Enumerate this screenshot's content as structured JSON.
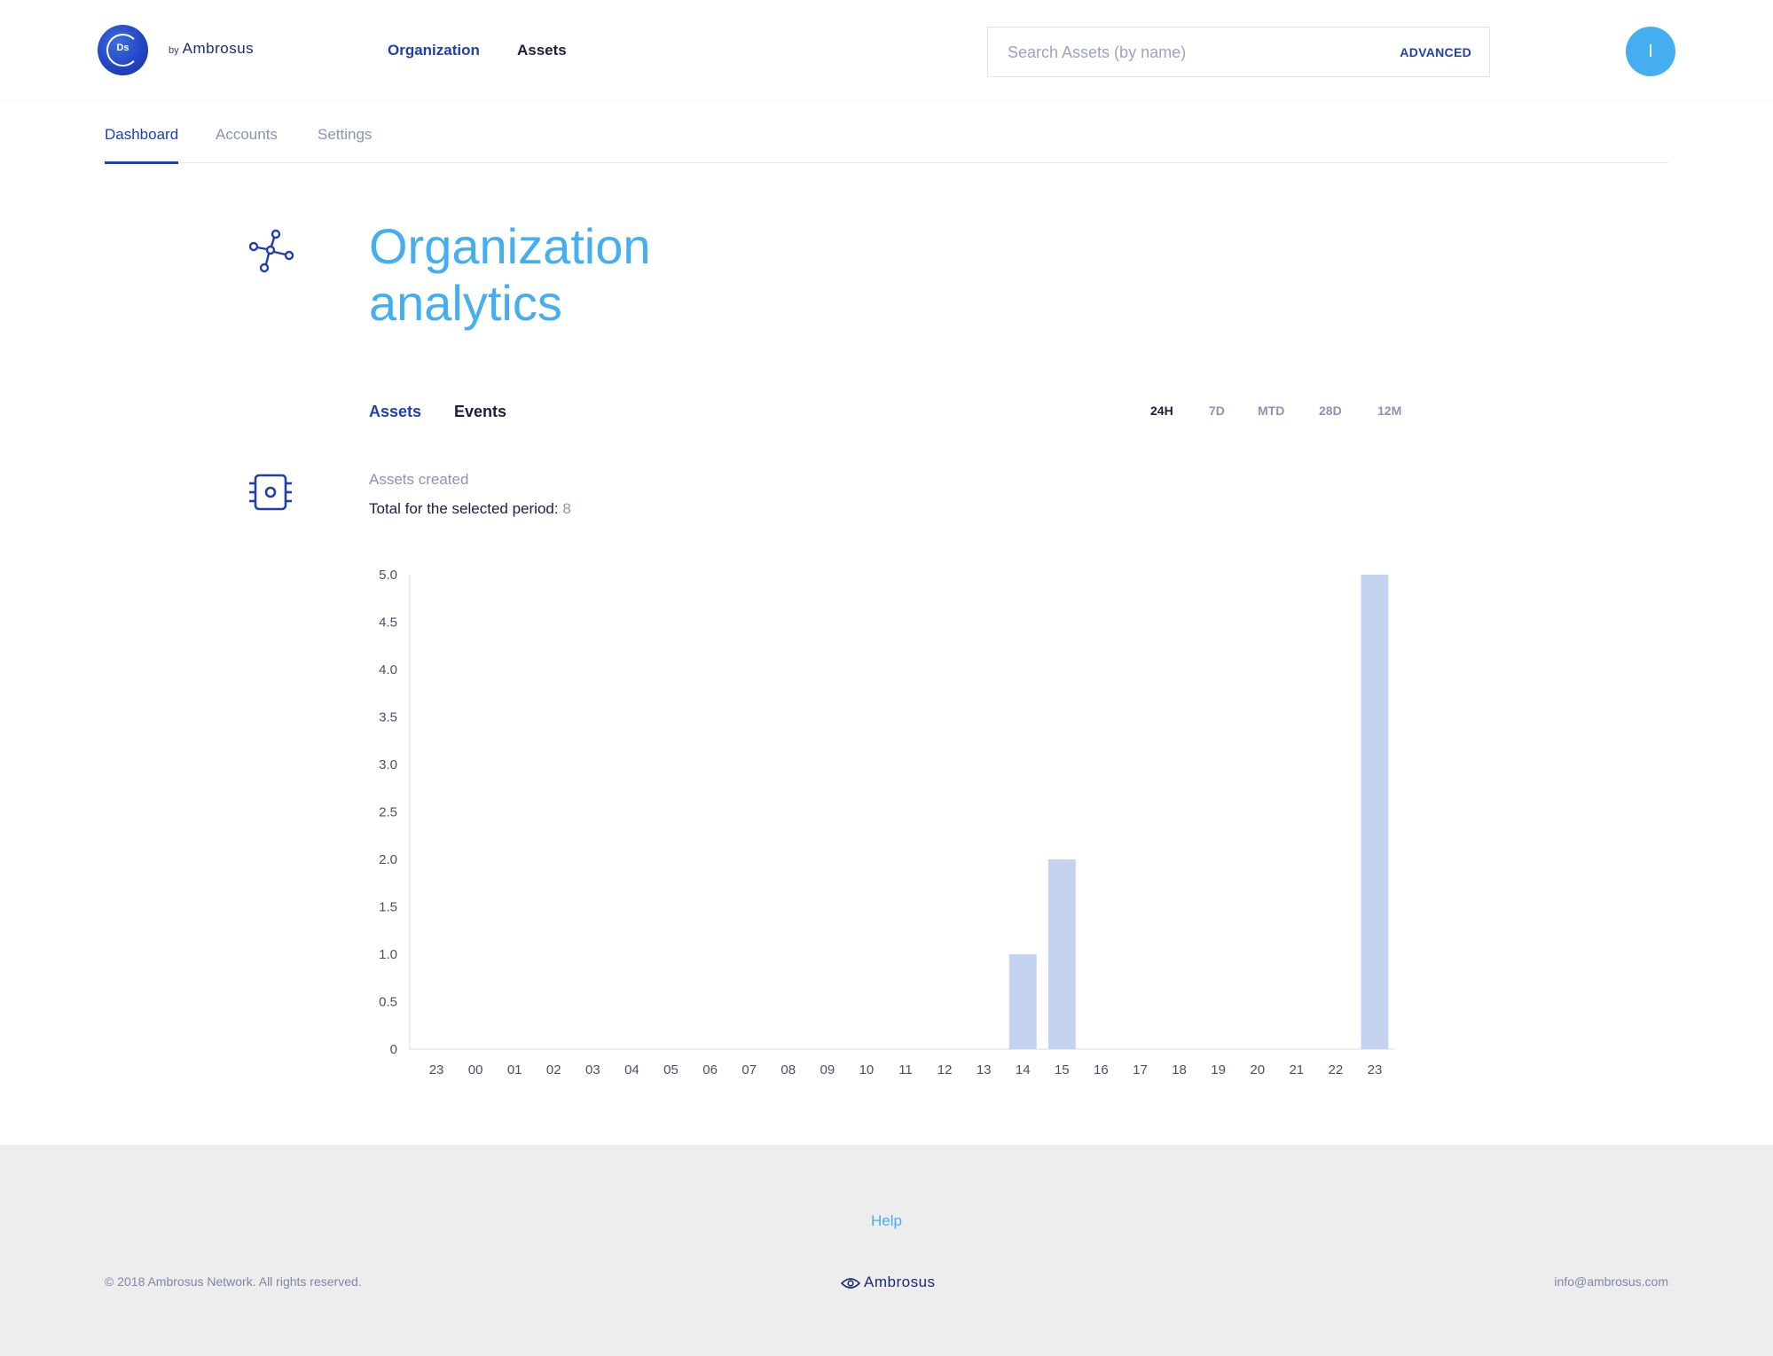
{
  "header": {
    "logo_text": "Ds",
    "by_text": "by",
    "brand": "Ambrosus",
    "nav": [
      {
        "label": "Organization"
      },
      {
        "label": "Assets"
      }
    ],
    "search": {
      "placeholder": "Search Assets (by name)",
      "advanced_label": "ADVANCED"
    },
    "avatar_initial": "I"
  },
  "subnav": {
    "items": [
      {
        "label": "Dashboard"
      },
      {
        "label": "Accounts"
      },
      {
        "label": "Settings"
      }
    ]
  },
  "page": {
    "title_line1": "Organization",
    "title_line2": "analytics",
    "tabs": [
      {
        "label": "Assets"
      },
      {
        "label": "Events"
      }
    ],
    "periods": [
      {
        "label": "24H"
      },
      {
        "label": "7D"
      },
      {
        "label": "MTD"
      },
      {
        "label": "28D"
      },
      {
        "label": "12M"
      }
    ],
    "section_label": "Assets created",
    "total_label": "Total for the selected period:",
    "total_value": "8"
  },
  "colors": {
    "accent_blue": "#1f3fb0",
    "light_blue": "#45aef0",
    "bar_fill": "#c3d2ee"
  },
  "chart_data": {
    "type": "bar",
    "categories": [
      "23",
      "00",
      "01",
      "02",
      "03",
      "04",
      "05",
      "06",
      "07",
      "08",
      "09",
      "10",
      "11",
      "12",
      "13",
      "14",
      "15",
      "16",
      "17",
      "18",
      "19",
      "20",
      "21",
      "22",
      "23"
    ],
    "values": [
      0,
      0,
      0,
      0,
      0,
      0,
      0,
      0,
      0,
      0,
      0,
      0,
      0,
      0,
      0,
      1,
      2,
      0,
      0,
      0,
      0,
      0,
      0,
      0,
      5
    ],
    "ylim": [
      0,
      5
    ],
    "yticks": [
      "0",
      "0.5",
      "1.0",
      "1.5",
      "2.0",
      "2.5",
      "3.0",
      "3.5",
      "4.0",
      "4.5",
      "5.0"
    ],
    "grid": false
  },
  "footer": {
    "help": "Help",
    "copyright": "© 2018 Ambrosus Network. All rights reserved.",
    "brand": "Ambrosus",
    "email": "info@ambrosus.com"
  }
}
